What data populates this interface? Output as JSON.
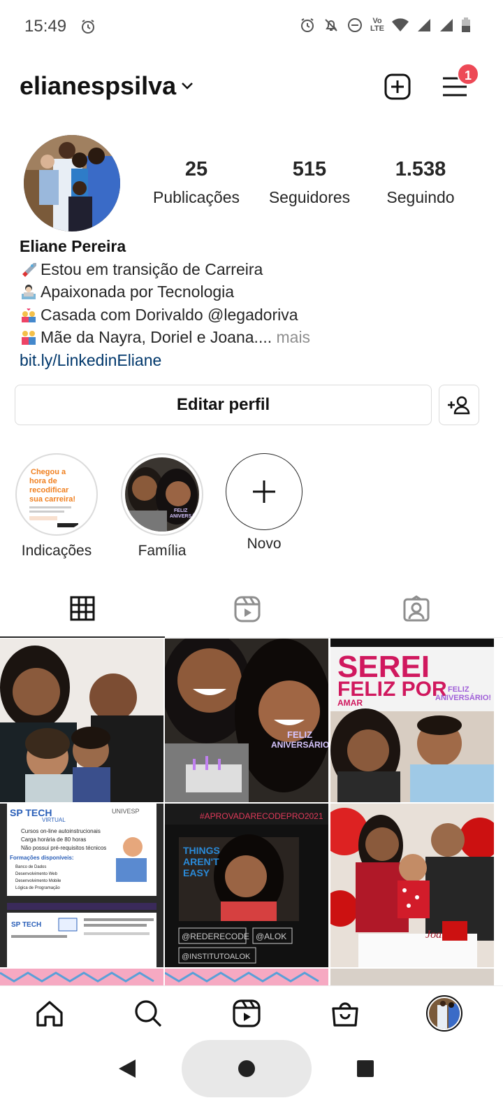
{
  "status_bar": {
    "time": "15:49",
    "volte_top": "Vo",
    "volte_bottom": "LTE"
  },
  "header": {
    "username": "elianespsilva",
    "notification_count": "1"
  },
  "profile": {
    "stats": [
      {
        "value": "25",
        "label": "Publicações"
      },
      {
        "value": "515",
        "label": "Seguidores"
      },
      {
        "value": "1.538",
        "label": "Seguindo"
      }
    ],
    "name": "Eliane Pereira",
    "bio_lines": [
      "Estou em transição de Carreira",
      "Apaixonada por Tecnologia",
      "Casada com Dorivaldo @legadoriva",
      "Mãe da Nayra, Doriel e Joana...."
    ],
    "more_label": " mais",
    "link": "bit.ly/LinkedinEliane",
    "edit_button": "Editar perfil"
  },
  "highlights": [
    {
      "label": "Indicações",
      "thumb_text": "Chegou a hora de recodificar sua carreira!"
    },
    {
      "label": "Família",
      "thumb_text": "FELIZ ANIVERSÁRIO!"
    },
    {
      "label": "Novo"
    }
  ],
  "grid_texts": {
    "post3_line1": "SEREI",
    "post3_line2": "FELIZ POR",
    "post3_line3": "AMAR",
    "post3_sticker": "FELIZ ANIVERSÁRIO!",
    "post2_sticker": "FELIZ ANIVERSÁRIO!",
    "post4_brand": "SP TECH",
    "post4_sub": "VIRTUAL",
    "post4_items": [
      "Cursos on-line autoinstrucionais",
      "Carga horária de 80 horas",
      "Não possui pré-requisitos técnicos"
    ],
    "post4_heading": "Formações disponíveis:",
    "post4_list": [
      "Banco de Dados",
      "Desenvolvimento Web",
      "Desenvolvimento Mobile",
      "Lógica de Programação"
    ],
    "post4_univ": "UNIVESP",
    "post5_hashtag": "#APROVADARECODEPRO2021",
    "post5_slogan": "THINGS AREN'T EASY",
    "post5_tags": [
      "@REDERECODE",
      "@ALOK",
      "@INSTITUTOALOK"
    ],
    "post6_cake": "Joana"
  },
  "icons": {
    "accent_badge": "#ed4956",
    "link_color": "#00376b"
  }
}
